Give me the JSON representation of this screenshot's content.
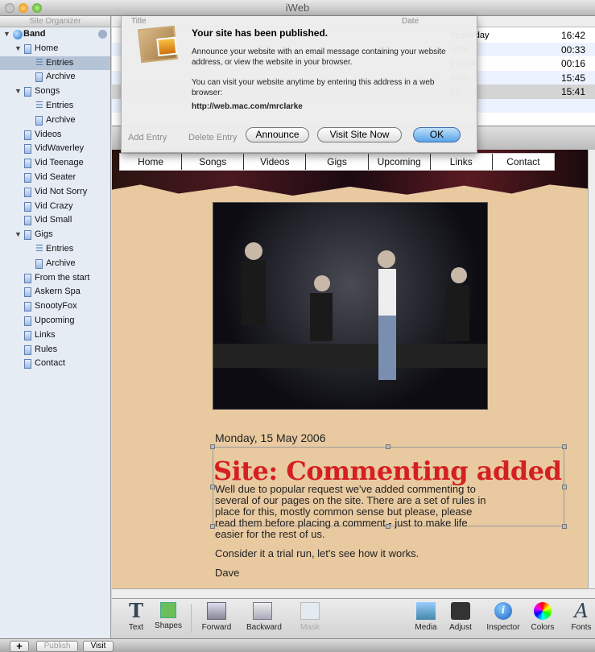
{
  "window": {
    "title": "iWeb"
  },
  "sidebar": {
    "header": "Site Organizer",
    "items": [
      {
        "label": "Band",
        "level": 0,
        "icon": "globe-icon",
        "expanded": true
      },
      {
        "label": "Home",
        "level": 1,
        "icon": "page-icon",
        "expanded": true
      },
      {
        "label": "Entries",
        "level": 2,
        "icon": "list-icon",
        "selected": true
      },
      {
        "label": "Archive",
        "level": 2,
        "icon": "page-icon"
      },
      {
        "label": "Songs",
        "level": 1,
        "icon": "page-icon",
        "expanded": true
      },
      {
        "label": "Entries",
        "level": 2,
        "icon": "list-icon"
      },
      {
        "label": "Archive",
        "level": 2,
        "icon": "page-icon"
      },
      {
        "label": "Videos",
        "level": 1,
        "icon": "page-icon"
      },
      {
        "label": "VidWaverley",
        "level": 1,
        "icon": "page-icon"
      },
      {
        "label": "Vid Teenage",
        "level": 1,
        "icon": "page-icon"
      },
      {
        "label": "Vid Seater",
        "level": 1,
        "icon": "page-icon"
      },
      {
        "label": "Vid Not Sorry",
        "level": 1,
        "icon": "page-icon"
      },
      {
        "label": "Vid Crazy",
        "level": 1,
        "icon": "page-icon"
      },
      {
        "label": "Vid Small",
        "level": 1,
        "icon": "page-icon"
      },
      {
        "label": "Gigs",
        "level": 1,
        "icon": "page-icon",
        "expanded": true
      },
      {
        "label": "Entries",
        "level": 2,
        "icon": "list-icon"
      },
      {
        "label": "Archive",
        "level": 2,
        "icon": "page-icon"
      },
      {
        "label": "From the start",
        "level": 1,
        "icon": "page-icon"
      },
      {
        "label": "Askern Spa",
        "level": 1,
        "icon": "page-icon"
      },
      {
        "label": "SnootyFox",
        "level": 1,
        "icon": "page-icon"
      },
      {
        "label": "Upcoming",
        "level": 1,
        "icon": "page-icon"
      },
      {
        "label": "Links",
        "level": 1,
        "icon": "page-icon"
      },
      {
        "label": "Rules",
        "level": 1,
        "icon": "page-icon"
      },
      {
        "label": "Contact",
        "level": 1,
        "icon": "page-icon"
      }
    ]
  },
  "entries": {
    "columns": [
      "Title",
      "Date"
    ],
    "rows": [
      {
        "date": "Yesterday",
        "time": "16:42"
      },
      {
        "date": "2006",
        "time": "00:33"
      },
      {
        "date": "y 2006",
        "time": "00:16"
      },
      {
        "date": "2006",
        "time": "15:45"
      },
      {
        "date": "06",
        "time": "15:41",
        "selected": true
      }
    ],
    "toolbar": [
      "Add Entry",
      "Delete Entry"
    ]
  },
  "dialog": {
    "title": "Your site has been published.",
    "message": "Announce your website with an email message containing your website address, or view the website in your browser.",
    "visit_text": "You can visit your website anytime by entering this address in a web browser:",
    "url": "http://web.mac.com/mrclarke",
    "buttons": {
      "announce": "Announce",
      "visit": "Visit Site Now",
      "ok": "OK"
    }
  },
  "page": {
    "nav": [
      "Home",
      "Songs",
      "Videos",
      "Gigs",
      "Upcoming",
      "Links",
      "Contact"
    ],
    "date": "Monday, 15 May 2006",
    "headline": "Site: Commenting added",
    "body": [
      "Well due to popular request we've added commenting to several of our pages on the site. There are a set of rules in place for this, mostly common sense but please, please read them before placing a comment - just to make life easier for the rest of us.",
      "Consider it a trial run, let's see how it works.",
      "Dave"
    ],
    "headline_color": "#d42020"
  },
  "toolbar": [
    {
      "label": "Text",
      "icon": "text-icon"
    },
    {
      "label": "Shapes",
      "icon": "shapes-icon"
    },
    {
      "label": "Forward",
      "icon": "bring-forward-icon"
    },
    {
      "label": "Backward",
      "icon": "send-backward-icon"
    },
    {
      "label": "Mask",
      "icon": "mask-icon",
      "disabled": true
    },
    {
      "label": "Media",
      "icon": "media-icon"
    },
    {
      "label": "Adjust",
      "icon": "adjust-icon"
    },
    {
      "label": "Inspector",
      "icon": "inspector-icon"
    },
    {
      "label": "Colors",
      "icon": "colors-icon"
    },
    {
      "label": "Fonts",
      "icon": "fonts-icon"
    }
  ],
  "bottom": {
    "add": "+",
    "publish": "Publish",
    "visit": "Visit"
  }
}
